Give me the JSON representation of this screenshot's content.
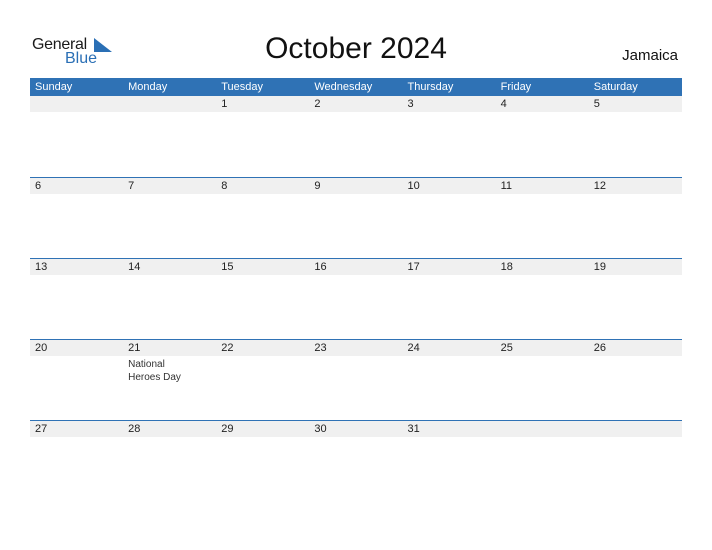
{
  "logo": {
    "general": "General",
    "blue": "Blue"
  },
  "title": "October 2024",
  "country": "Jamaica",
  "colors": {
    "accent": "#2f72b5",
    "date_row_bg": "#f0f0f0"
  },
  "weekdays": [
    "Sunday",
    "Monday",
    "Tuesday",
    "Wednesday",
    "Thursday",
    "Friday",
    "Saturday"
  ],
  "weeks": [
    {
      "days": [
        "",
        "",
        "1",
        "2",
        "3",
        "4",
        "5"
      ],
      "events": [
        "",
        "",
        "",
        "",
        "",
        "",
        ""
      ]
    },
    {
      "days": [
        "6",
        "7",
        "8",
        "9",
        "10",
        "11",
        "12"
      ],
      "events": [
        "",
        "",
        "",
        "",
        "",
        "",
        ""
      ]
    },
    {
      "days": [
        "13",
        "14",
        "15",
        "16",
        "17",
        "18",
        "19"
      ],
      "events": [
        "",
        "",
        "",
        "",
        "",
        "",
        ""
      ]
    },
    {
      "days": [
        "20",
        "21",
        "22",
        "23",
        "24",
        "25",
        "26"
      ],
      "events": [
        "",
        "National Heroes Day",
        "",
        "",
        "",
        "",
        ""
      ]
    },
    {
      "days": [
        "27",
        "28",
        "29",
        "30",
        "31",
        "",
        ""
      ],
      "events": [
        "",
        "",
        "",
        "",
        "",
        "",
        ""
      ]
    }
  ]
}
